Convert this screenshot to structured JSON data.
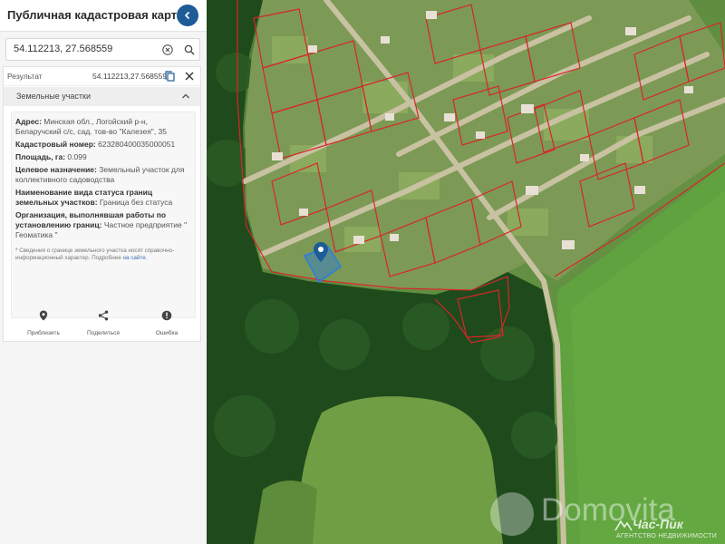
{
  "header": {
    "title": "Публичная кадастровая карта"
  },
  "search": {
    "value": "54.112213, 27.568559"
  },
  "result": {
    "label": "Результат",
    "coords": "54.112213,27.568559",
    "section_title": "Земельные участки",
    "fields": [
      {
        "label": "Адрес:",
        "value": "Минская обл., Логойский р-н, Беларучский с/с, сад. тов-во \"Калезея\", 35"
      },
      {
        "label": "Кадастровый номер:",
        "value": "623280400035000051"
      },
      {
        "label": "Площадь, га:",
        "value": "0.099"
      },
      {
        "label": "Целевое назначение:",
        "value": "Земельный участок для коллективного садоводства"
      },
      {
        "label": "Наименование вида статуса границ земельных участков:",
        "value": "Граница без статуса"
      },
      {
        "label": "Организация, выполнявшая работы по установлению границ:",
        "value": "Частное предприятие \" Геоматика \""
      }
    ],
    "note": "* Сведения о границе земельного участка носят справочно-информационный характер. Подробнее ",
    "note_link": "на сайте.",
    "actions": {
      "zoom": "Приблизить",
      "share": "Поделиться",
      "error": "Ошибка"
    }
  },
  "watermarks": {
    "domovita": "Domovita",
    "chas_pik": "Час-Пик",
    "chas_pik_sub": "АГЕНТСТВО НЕДВИЖИМОСТИ"
  },
  "colors": {
    "panel_bg": "#f5f5f5",
    "accent": "#1e5c97",
    "boundary": "#d8262a",
    "selected_parcel": "#2c7de0"
  },
  "icons": [
    "chevron-left-icon",
    "clear-icon",
    "search-icon",
    "copy-icon",
    "close-icon",
    "chevron-up-icon",
    "location-pin-icon",
    "share-icon",
    "error-icon"
  ]
}
